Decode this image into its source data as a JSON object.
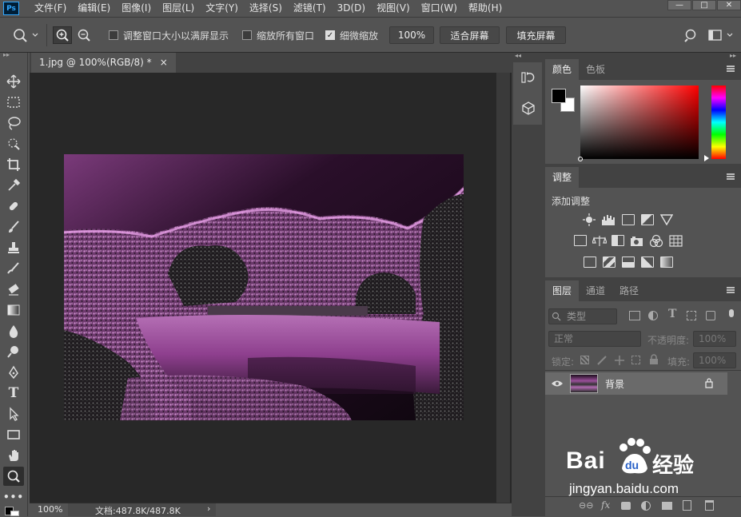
{
  "app": {
    "logo": "Ps"
  },
  "menus": [
    "文件(F)",
    "编辑(E)",
    "图像(I)",
    "图层(L)",
    "文字(Y)",
    "选择(S)",
    "滤镜(T)",
    "3D(D)",
    "视图(V)",
    "窗口(W)",
    "帮助(H)"
  ],
  "window_controls": [
    "—",
    "□",
    "✕"
  ],
  "options": {
    "resize_windows": "调整窗口大小以满屏显示",
    "zoom_all": "缩放所有窗口",
    "scrubby_zoom": "细微缩放",
    "zoom_value": "100%",
    "fit_screen": "适合屏幕",
    "fill_screen": "填充屏幕"
  },
  "document": {
    "tab_title": "1.jpg @ 100%(RGB/8) *",
    "tab_close": "×"
  },
  "status": {
    "zoom": "100%",
    "doc_size": "文档:487.8K/487.8K",
    "arrow": "›"
  },
  "color_panel": {
    "tabs": [
      "颜色",
      "色板"
    ],
    "fg_color": "#000000",
    "bg_color": "#ffffff"
  },
  "adjust_panel": {
    "tab": "调整",
    "heading": "添加调整"
  },
  "layers_panel": {
    "tabs": [
      "图层",
      "通道",
      "路径"
    ],
    "filter_kind": "类型",
    "blend_mode": "正常",
    "opacity_label": "不透明度:",
    "opacity_value": "100%",
    "lock_label": "锁定:",
    "fill_label": "填充:",
    "fill_value": "100%",
    "layer_name": "背景"
  },
  "watermark": {
    "brand": "Bai",
    "brand2": "du",
    "product": "经验",
    "url": "jingyan.baidu.com"
  },
  "colors": {
    "accent": "#31a8ff",
    "image_tint": "#b45ab4"
  }
}
